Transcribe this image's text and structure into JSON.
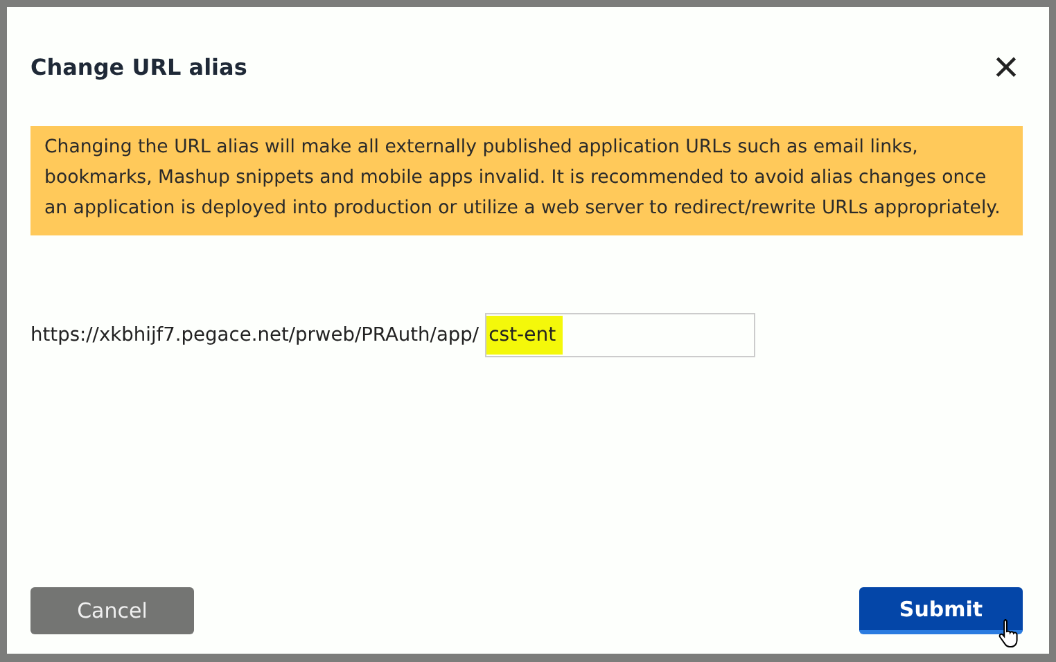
{
  "dialog": {
    "title": "Change URL alias",
    "close": "×"
  },
  "warning": "Changing the URL alias will make all externally published application URLs such as email links, bookmarks, Mashup snippets and mobile apps invalid. It is recommended to avoid alias changes once an application is deployed into production or utilize a web server to redirect/rewrite URLs appropriately.",
  "url": {
    "prefix": "https://xkbhijf7.pegace.net/prweb/PRAuth/app/",
    "value": "cst-ent",
    "highlighted": true
  },
  "buttons": [
    {
      "label": "Cancel",
      "kind": "secondary"
    },
    {
      "label": "Submit",
      "kind": "primary"
    }
  ]
}
